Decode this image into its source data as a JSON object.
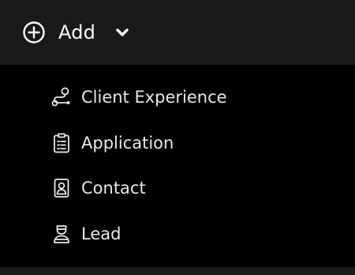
{
  "add_menu": {
    "label": "Add",
    "icons": {
      "add": "circle-plus-icon",
      "toggle": "chevron-down-icon"
    },
    "items": [
      {
        "label": "Client Experience",
        "icon": "journey-route-icon"
      },
      {
        "label": "Application",
        "icon": "clipboard-list-icon"
      },
      {
        "label": "Contact",
        "icon": "contact-card-icon"
      },
      {
        "label": "Lead",
        "icon": "person-badge-icon"
      }
    ]
  },
  "colors": {
    "header_bg": "#1a1a1a",
    "menu_bg": "#000000",
    "text": "#ffffff"
  }
}
